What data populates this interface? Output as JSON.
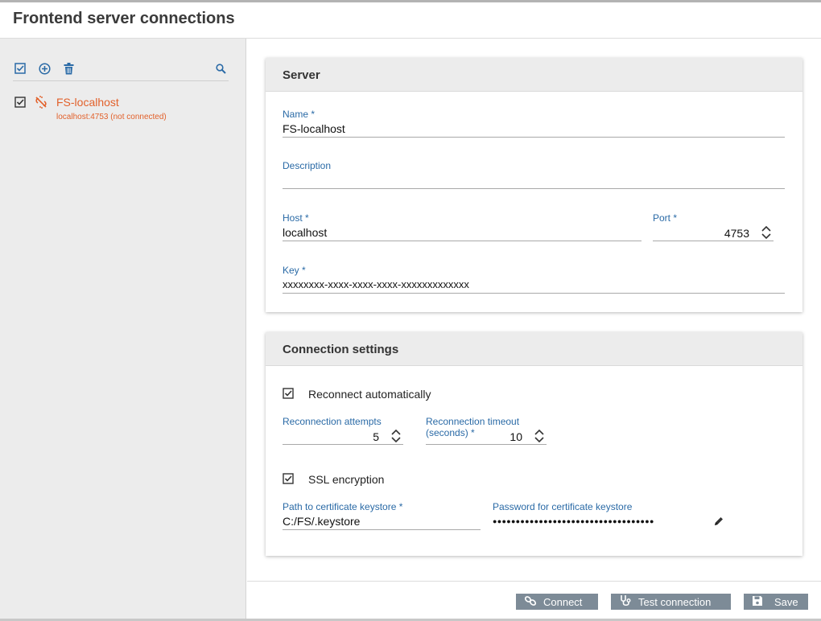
{
  "page": {
    "title": "Frontend server connections"
  },
  "sidebar": {
    "toolbar": {
      "check_icon": "check-all-icon",
      "add_icon": "add-circle-icon",
      "delete_icon": "trash-icon",
      "search_icon": "search-icon"
    },
    "servers": [
      {
        "name": "FS-localhost",
        "status": "localhost:4753 (not connected)",
        "checked": true,
        "icon": "disconnected-plug-icon"
      }
    ]
  },
  "server_card": {
    "title": "Server",
    "name": {
      "label": "Name *",
      "value": "FS-localhost"
    },
    "description": {
      "label": "Description",
      "value": ""
    },
    "host": {
      "label": "Host *",
      "value": "localhost"
    },
    "port": {
      "label": "Port *",
      "value": "4753"
    },
    "key": {
      "label": "Key *",
      "value": "xxxxxxxx-xxxx-xxxx-xxxx-xxxxxxxxxxxxx"
    }
  },
  "connection_card": {
    "title": "Connection settings",
    "reconnect": {
      "label": "Reconnect automatically",
      "checked": true
    },
    "attempts": {
      "label": "Reconnection attempts",
      "value": "5"
    },
    "timeout": {
      "label_line1": "Reconnection timeout",
      "label_line2": "(seconds) *",
      "value": "10"
    },
    "ssl": {
      "label": "SSL encryption",
      "checked": true
    },
    "keystore_path": {
      "label": "Path to certificate keystore *",
      "value": "C:/FS/.keystore"
    },
    "keystore_password": {
      "label": "Password for certificate keystore",
      "value": "●●●●●●●●●●●●●●●●●●●●●●●●●●●●●●●●●●●"
    }
  },
  "footer": {
    "connect_label": "Connect",
    "test_label": "Test connection",
    "save_label": "Save"
  },
  "colors": {
    "accent": "#2a6aa6",
    "warning": "#e2612b",
    "button": "#7d8b97"
  }
}
